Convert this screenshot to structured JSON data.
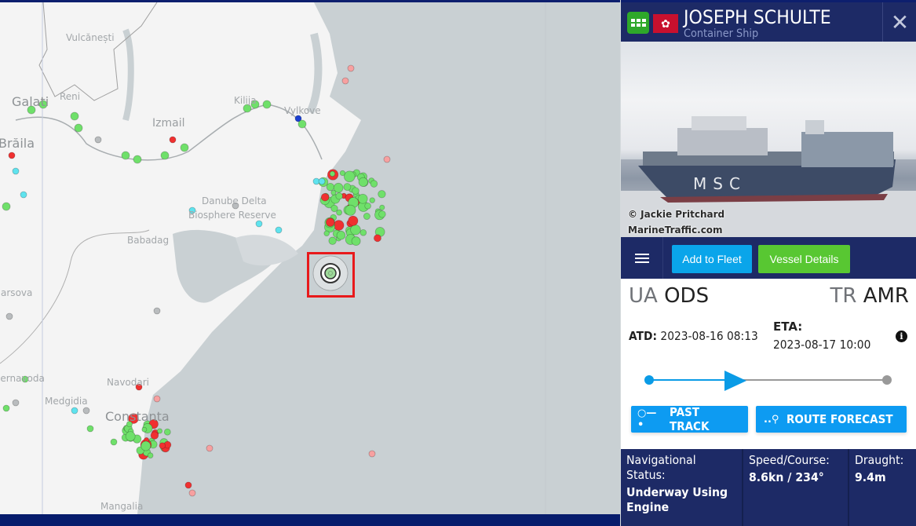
{
  "vessel": {
    "name": "JOSEPH SCHULTE",
    "type": "Container Ship",
    "flag": "Hong Kong",
    "type_color": "#2ea82a",
    "flag_color": "#c8102e"
  },
  "photo": {
    "credit": "© Jackie Pritchard",
    "source": "MarineTraffic.com",
    "hull_text": "MSC"
  },
  "actions": {
    "menu_icon": "hamburger-icon",
    "add_to_fleet": "Add to Fleet",
    "vessel_details": "Vessel Details"
  },
  "route": {
    "from_country": "UA",
    "from_port": "ODS",
    "to_country": "TR",
    "to_port": "AMR",
    "atd_label": "ATD:",
    "atd_value": "2023-08-16 08:13",
    "eta_label": "ETA:",
    "eta_value": "2023-08-17 10:00",
    "progress_fraction": 0.36
  },
  "track_buttons": {
    "past_track": "PAST TRACK",
    "route_forecast": "ROUTE FORECAST"
  },
  "stats": {
    "nav_status_label": "Navigational Status:",
    "nav_status_value": "Underway Using Engine",
    "speed_course_label": "Speed/Course:",
    "speed_course_value": "8.6kn / 234°",
    "draught_label": "Draught:",
    "draught_value": "9.4m"
  },
  "map": {
    "labels": [
      "Vulcănești",
      "Galati",
      "Reni",
      "Izmail",
      "Kilija",
      "Vylkove",
      "Brăila",
      "Danube Delta",
      "Biosphere Reserve",
      "Babadag",
      "Harsova",
      "Cernavoda",
      "Navodari",
      "Medgidia",
      "Constanta",
      "Mangalia"
    ],
    "colors": {
      "sea": "#c9d0d3",
      "land": "#f4f4f4",
      "selection": "#e8191b"
    }
  }
}
